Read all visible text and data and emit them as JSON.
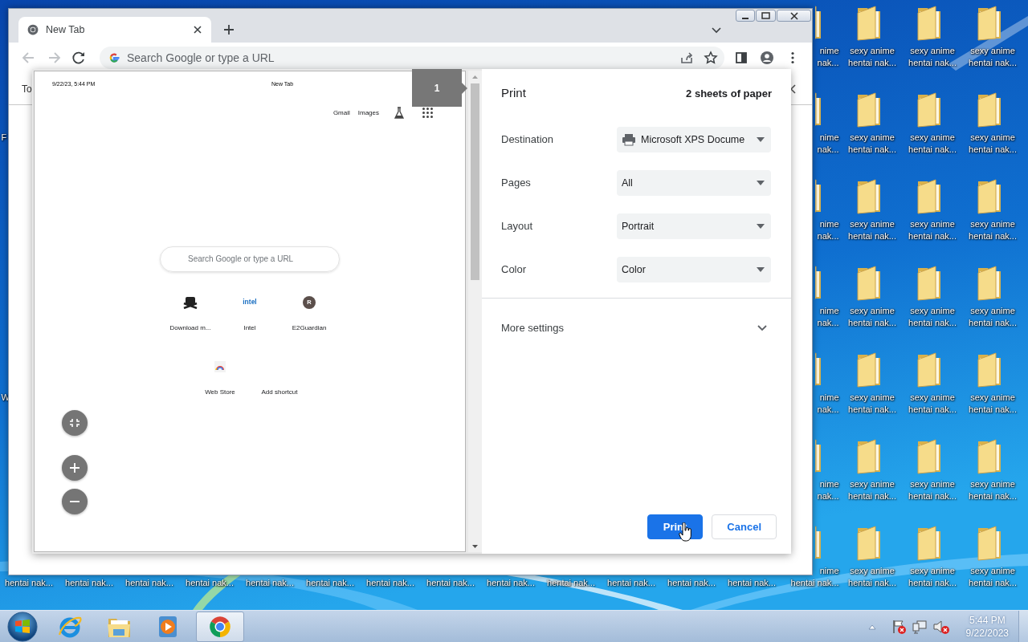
{
  "desktop": {
    "rows": [
      {
        "icons": [
          {
            "kind": "cut",
            "lines": [
              "nime",
              "nak..."
            ]
          },
          {
            "kind": "full",
            "lines": [
              "sexy anime",
              "hentai nak..."
            ]
          },
          {
            "kind": "full",
            "lines": [
              "sexy anime",
              "hentai nak..."
            ]
          },
          {
            "kind": "full",
            "lines": [
              "sexy anime",
              "hentai nak..."
            ]
          }
        ]
      },
      {
        "icons": [
          {
            "kind": "edge",
            "lines": [
              "F"
            ]
          },
          {
            "kind": "cut",
            "lines": [
              "nime",
              "nak..."
            ]
          },
          {
            "kind": "full",
            "lines": [
              "sexy anime",
              "hentai nak..."
            ]
          },
          {
            "kind": "full",
            "lines": [
              "sexy anime",
              "hentai nak..."
            ]
          },
          {
            "kind": "full",
            "lines": [
              "sexy anime",
              "hentai nak..."
            ]
          }
        ]
      },
      {
        "icons": [
          {
            "kind": "cut",
            "lines": [
              "nime",
              "nak..."
            ]
          },
          {
            "kind": "full",
            "lines": [
              "sexy anime",
              "hentai nak..."
            ]
          },
          {
            "kind": "full",
            "lines": [
              "sexy anime",
              "hentai nak..."
            ]
          },
          {
            "kind": "full",
            "lines": [
              "sexy anime",
              "hentai nak..."
            ]
          }
        ]
      },
      {
        "icons": [
          {
            "kind": "cut",
            "lines": [
              "nime",
              "nak..."
            ]
          },
          {
            "kind": "full",
            "lines": [
              "sexy anime",
              "hentai nak..."
            ]
          },
          {
            "kind": "full",
            "lines": [
              "sexy anime",
              "hentai nak..."
            ]
          },
          {
            "kind": "full",
            "lines": [
              "sexy anime",
              "hentai nak..."
            ]
          }
        ]
      },
      {
        "icons": [
          {
            "kind": "edge",
            "lines": [
              "W"
            ]
          },
          {
            "kind": "cut",
            "lines": [
              "nime",
              "nak..."
            ]
          },
          {
            "kind": "full",
            "lines": [
              "sexy anime",
              "hentai nak..."
            ]
          },
          {
            "kind": "full",
            "lines": [
              "sexy anime",
              "hentai nak..."
            ]
          },
          {
            "kind": "full",
            "lines": [
              "sexy anime",
              "hentai nak..."
            ]
          }
        ]
      },
      {
        "icons": [
          {
            "kind": "cut",
            "lines": [
              "nime",
              "nak..."
            ]
          },
          {
            "kind": "full",
            "lines": [
              "sexy anime",
              "hentai nak..."
            ]
          },
          {
            "kind": "full",
            "lines": [
              "sexy anime",
              "hentai nak..."
            ]
          },
          {
            "kind": "full",
            "lines": [
              "sexy anime",
              "hentai nak..."
            ]
          }
        ]
      },
      {
        "icons": [
          {
            "kind": "lower",
            "lines": [
              "hentai nak..."
            ]
          },
          {
            "kind": "lower",
            "lines": [
              "hentai nak..."
            ]
          },
          {
            "kind": "lower",
            "lines": [
              "hentai nak..."
            ]
          },
          {
            "kind": "lower",
            "lines": [
              "hentai nak..."
            ]
          },
          {
            "kind": "lower",
            "lines": [
              "hentai nak..."
            ]
          },
          {
            "kind": "lower",
            "lines": [
              "hentai nak..."
            ]
          },
          {
            "kind": "lower",
            "lines": [
              "hentai nak..."
            ]
          },
          {
            "kind": "lower",
            "lines": [
              "hentai nak..."
            ]
          },
          {
            "kind": "lower",
            "lines": [
              "hentai nak..."
            ]
          },
          {
            "kind": "lower",
            "lines": [
              "hentai nak..."
            ]
          },
          {
            "kind": "lower",
            "lines": [
              "hentai nak..."
            ]
          },
          {
            "kind": "lower",
            "lines": [
              "hentai nak..."
            ]
          },
          {
            "kind": "lower",
            "lines": [
              "hentai nak..."
            ]
          },
          {
            "kind": "cut",
            "lines": [
              "nime",
              "hentai nak..."
            ]
          },
          {
            "kind": "full",
            "lines": [
              "sexy anime",
              "hentai nak..."
            ]
          },
          {
            "kind": "full",
            "lines": [
              "sexy anime",
              "hentai nak..."
            ]
          },
          {
            "kind": "full",
            "lines": [
              "sexy anime",
              "hentai nak..."
            ]
          }
        ]
      }
    ]
  },
  "browser": {
    "tabs": [
      {
        "title": "New Tab",
        "selected": true
      }
    ],
    "nav_buttons": [
      {
        "kind": "back",
        "disabled": true
      },
      {
        "kind": "forward",
        "disabled": true
      },
      {
        "kind": "reload",
        "disabled": false
      }
    ],
    "omnibox": {
      "placeholder": "Search Google or type a URL"
    },
    "page_behind": {
      "text": "To"
    }
  },
  "print_dialog": {
    "preview": {
      "page_number": "1",
      "header_date": "9/22/23, 5:44 PM",
      "header_title": "New Tab",
      "top_links": [
        "Gmail",
        "Images"
      ],
      "search_placeholder": "Search Google or type a URL",
      "shortcut_rows": [
        [
          {
            "kind": "crossbones",
            "label": "Download m..."
          },
          {
            "kind": "logo",
            "logo_text": "intel",
            "label": "Intel"
          },
          {
            "kind": "letter",
            "letter": "R",
            "label": "E2Guardian"
          }
        ],
        [
          {
            "kind": "store",
            "label": "Web Store"
          },
          {
            "kind": "add",
            "label": "Add shortcut"
          }
        ]
      ]
    },
    "title": "Print",
    "sheets": "2 sheets of paper",
    "settings": [
      {
        "label": "Destination",
        "value": "Microsoft XPS Docume",
        "kind": "printer"
      },
      {
        "label": "Pages",
        "value": "All",
        "kind": "plain"
      },
      {
        "label": "Layout",
        "value": "Portrait",
        "kind": "plain"
      },
      {
        "label": "Color",
        "value": "Color",
        "kind": "plain"
      }
    ],
    "more_settings": "More settings",
    "buttons": [
      {
        "label": "Print",
        "kind": "primary"
      },
      {
        "label": "Cancel",
        "kind": "secondary"
      }
    ]
  },
  "taskbar": {
    "apps": [
      {
        "kind": "ie",
        "selected": false
      },
      {
        "kind": "explorer",
        "selected": false
      },
      {
        "kind": "media",
        "selected": false
      },
      {
        "kind": "chrome",
        "selected": true
      }
    ],
    "clock": {
      "time": "5:44 PM",
      "date": "9/22/2023"
    }
  }
}
